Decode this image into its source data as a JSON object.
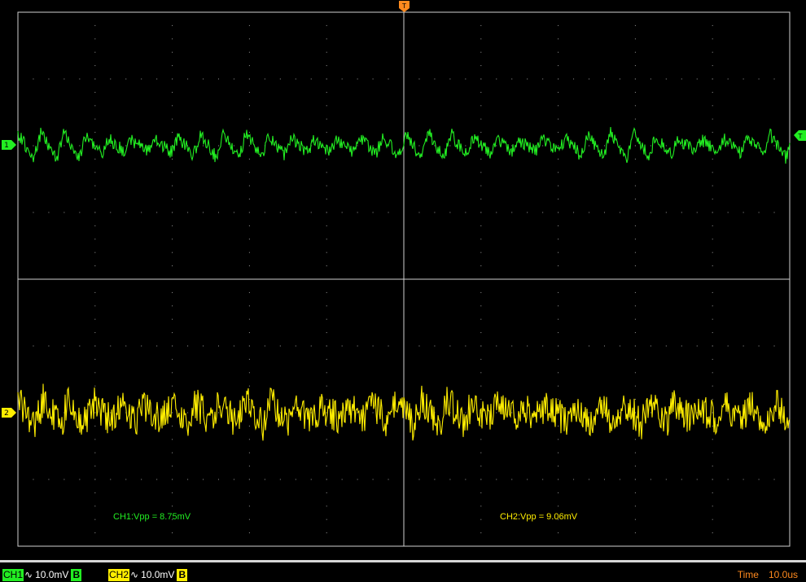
{
  "colors": {
    "ch1": "#22ee22",
    "ch2": "#ffee00",
    "trigger": "#ff8a1e",
    "grid": "#9a9a9a",
    "border": "#d0d0d0"
  },
  "trigger_marker": {
    "label": "T"
  },
  "channels": [
    {
      "id": "CH1",
      "marker_label": "1",
      "coupling_symbol": "∿",
      "volts_per_div": "10.0mV",
      "bandwidth_label": "B",
      "measurement": "CH1:Vpp = 8.75mV"
    },
    {
      "id": "CH2",
      "marker_label": "2",
      "coupling_symbol": "∿",
      "volts_per_div": "10.0mV",
      "bandwidth_label": "B",
      "measurement": "CH2:Vpp = 9.06mV"
    }
  ],
  "timebase": {
    "label": "Time",
    "value": "10.0us"
  },
  "chart_data": {
    "type": "line",
    "grid": true,
    "horizontal_divisions": 10,
    "vertical_divisions": 8,
    "series": [
      {
        "name": "CH1",
        "vpp_mV": 8.75,
        "offset_div": 6.0,
        "volts_per_div_mV": 10.0
      },
      {
        "name": "CH2",
        "vpp_mV": 9.06,
        "offset_div": 2.0,
        "volts_per_div_mV": 10.0
      }
    ]
  }
}
